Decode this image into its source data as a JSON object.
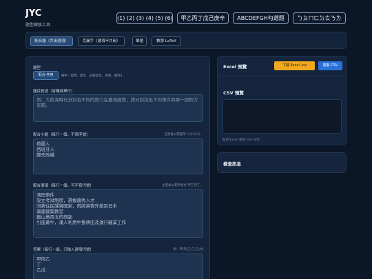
{
  "app": {
    "title": "JYC",
    "subtitle": "題型轉換工具"
  },
  "format_buttons": [
    "(1) (2) (3) (4) (5) (6)",
    "甲乙丙丁戊己庚辛",
    "ABCDEFGH勾選題",
    "ㄅㄆㄇㄈㄉㄊㄋㄌ"
  ],
  "nav_tabs": [
    "配合題（共用選項）",
    "克漏字（選項不共用）",
    "單選",
    "數學 LaTeX"
  ],
  "form": {
    "type_label": "題型",
    "type_selected": "配合-共用",
    "type_desc": "欄中：提問、提示、正確答案、說明、選項3…",
    "stem_label": "題目敘述（會轉成單行）",
    "stem_placeholder": "例：大航海時代分別有不同的勢力在臺灣經營，請分別找出下列事件與哪一個勢力有關。",
    "sub_label": "配合小題（每行一個，不寫序號）",
    "sub_hint": "主題會以範圍所 (1)(2)(3)…",
    "sub_value": "荷蘭人\n西班牙人\n鄭氏政權",
    "opt_label": "配合選項（每行一個，可不寫代號）",
    "opt_hint": "主選會以範例格式 甲乙丙丁…",
    "opt_value": "濱田事件\n設立考試制度，選拔優秀人才\n向新住民課貿國家，再將貨物外銷到日本\n興建建築教堂\n雞山島南北的興起\n引進黃牛，漢人利用牛隻耕田及運行糖業工作",
    "ans_label": "答案（每行一個，只輸入選項代號）",
    "ans_hint": "例：甲/丙/乙/丁/乙/戊",
    "ans_value": "甲丙乙\n丁\n乙戊"
  },
  "excel": {
    "title": "Excel 預覽",
    "download_label": "下載 Excel .xls",
    "copy_label": "複製 CSV",
    "csv_title": "CSV 預覽",
    "csv_note": "貼到 Excel 會依 CSV 分行。"
  },
  "check": {
    "title": "檢查訊息"
  },
  "colors": {
    "accent": "#f0a81e",
    "primary": "#2b72d8",
    "background": "#0b1626"
  }
}
